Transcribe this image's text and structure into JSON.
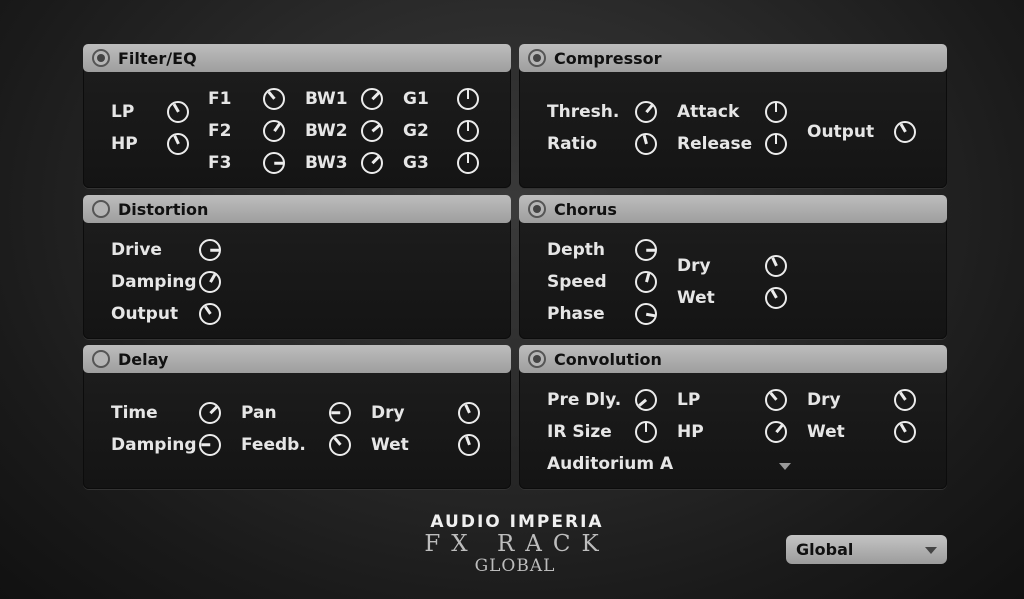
{
  "panels": {
    "filter": {
      "title": "Filter/EQ",
      "enabled": true,
      "lp": "LP",
      "hp": "HP",
      "f1": "F1",
      "f2": "F2",
      "f3": "F3",
      "bw1": "BW1",
      "bw2": "BW2",
      "bw3": "BW3",
      "g1": "G1",
      "g2": "G2",
      "g3": "G3"
    },
    "compressor": {
      "title": "Compressor",
      "enabled": true,
      "thresh": "Thresh.",
      "ratio": "Ratio",
      "attack": "Attack",
      "release": "Release",
      "output": "Output"
    },
    "distortion": {
      "title": "Distortion",
      "enabled": false,
      "drive": "Drive",
      "damping": "Damping",
      "output": "Output"
    },
    "chorus": {
      "title": "Chorus",
      "enabled": true,
      "depth": "Depth",
      "speed": "Speed",
      "phase": "Phase",
      "dry": "Dry",
      "wet": "Wet"
    },
    "delay": {
      "title": "Delay",
      "enabled": false,
      "time": "Time",
      "damping": "Damping",
      "pan": "Pan",
      "feedb": "Feedb.",
      "dry": "Dry",
      "wet": "Wet"
    },
    "convolution": {
      "title": "Convolution",
      "enabled": true,
      "predly": "Pre Dly.",
      "irsize": "IR Size",
      "lp": "LP",
      "hp": "HP",
      "dry": "Dry",
      "wet": "Wet",
      "ir_selected": "Auditorium A"
    }
  },
  "logo": {
    "line1": "AUDIO IMPERIA",
    "line2": "FX RACK",
    "line3": "GLOBAL"
  },
  "global_select": {
    "value": "Global"
  },
  "knob_angles": {
    "lp": -30,
    "hp": -25,
    "f1": -40,
    "f2": 35,
    "f3": 90,
    "bw1": 45,
    "bw2": 50,
    "bw3": 45,
    "g1": 0,
    "g2": 0,
    "g3": 0,
    "thresh": 40,
    "ratio": -15,
    "attack": 0,
    "release": 0,
    "comp_output": -30,
    "drive": 90,
    "dist_damping": 30,
    "dist_output": -35,
    "depth": 90,
    "speed": 15,
    "phase": 100,
    "chorus_dry": -25,
    "chorus_wet": -30,
    "time": 45,
    "delay_damping": -90,
    "pan": -90,
    "feedb": -40,
    "delay_dry": -25,
    "delay_wet": -20,
    "predly": -130,
    "irsize": 0,
    "conv_lp": -40,
    "conv_hp": 40,
    "conv_dry": -35,
    "conv_wet": -30
  }
}
